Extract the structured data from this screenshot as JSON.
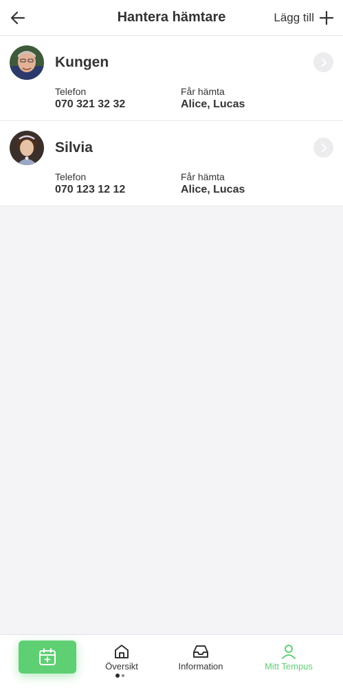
{
  "header": {
    "title": "Hantera hämtare",
    "add_label": "Lägg till"
  },
  "pickups": [
    {
      "name": "Kungen",
      "phone_label": "Telefon",
      "phone": "070 321 32 32",
      "allowed_label": "Får hämta",
      "allowed": "Alice, Lucas"
    },
    {
      "name": "Silvia",
      "phone_label": "Telefon",
      "phone": "070 123 12 12",
      "allowed_label": "Får hämta",
      "allowed": "Alice, Lucas"
    }
  ],
  "tabbar": {
    "tabs": [
      {
        "label": "Översikt",
        "icon": "home-icon"
      },
      {
        "label": "Information",
        "icon": "inbox-icon"
      },
      {
        "label": "Mitt Tempus",
        "icon": "user-icon"
      }
    ],
    "active_tab": "Mitt Tempus",
    "calendar_icon": "calendar-add-icon"
  },
  "colors": {
    "accent": "#5fcf74",
    "background": "#f4f3f6",
    "card": "#ffffff"
  }
}
